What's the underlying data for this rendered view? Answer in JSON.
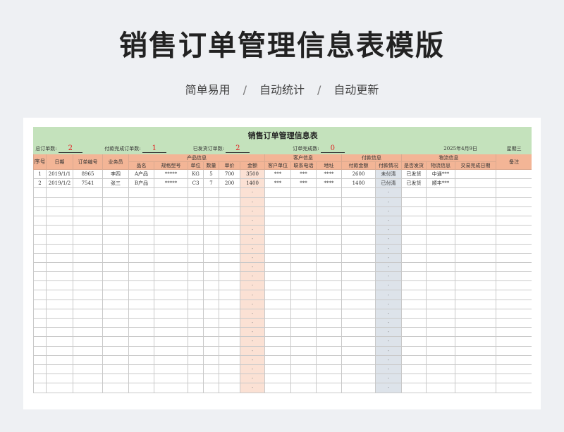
{
  "page": {
    "title": "销售订单管理信息表模版",
    "subtitle": [
      "简单易用",
      "自动统计",
      "自动更新"
    ],
    "separator": "/"
  },
  "sheet": {
    "title": "销售订单管理信息表",
    "summary": {
      "total_label": "总订单数:",
      "total_value": "2",
      "paid_label": "付款完成订单数:",
      "paid_value": "1",
      "shipped_label": "已发货订单数:",
      "shipped_value": "2",
      "done_label": "订单完成数:",
      "done_value": "0",
      "date": "2025年4月9日",
      "weekday": "星期三"
    },
    "group_headers": {
      "product": "产品信息",
      "customer": "客户信息",
      "payment": "付款信息",
      "logistics": "物流信息"
    },
    "columns": {
      "seq": "序号",
      "date": "日期",
      "order_no": "订单编号",
      "salesman": "业务员",
      "product_name": "品名",
      "spec": "规格型号",
      "unit": "单位",
      "qty": "数量",
      "price": "单价",
      "amount": "金额",
      "customer_unit": "客户单位",
      "phone": "联系电话",
      "address": "地址",
      "paid_amount": "付款金额",
      "pay_status": "付款情况",
      "shipped": "是否发货",
      "logistics": "物流信息",
      "done_date": "交易完成日期",
      "remark": "备注"
    },
    "rows": [
      [
        "1",
        "2019/1/1",
        "8965",
        "李四",
        "A产品",
        "*****",
        "KG",
        "5",
        "700",
        "3500",
        "***",
        "***",
        "****",
        "2600",
        "未付清",
        "已发货",
        "中通***",
        "",
        ""
      ],
      [
        "2",
        "2019/1/2",
        "7541",
        "张三",
        "B产品",
        "*****",
        "C3",
        "7",
        "200",
        "1400",
        "***",
        "***",
        "****",
        "1400",
        "已付清",
        "已发货",
        "顺丰***",
        "",
        ""
      ]
    ],
    "empty_placeholder": "-"
  }
}
